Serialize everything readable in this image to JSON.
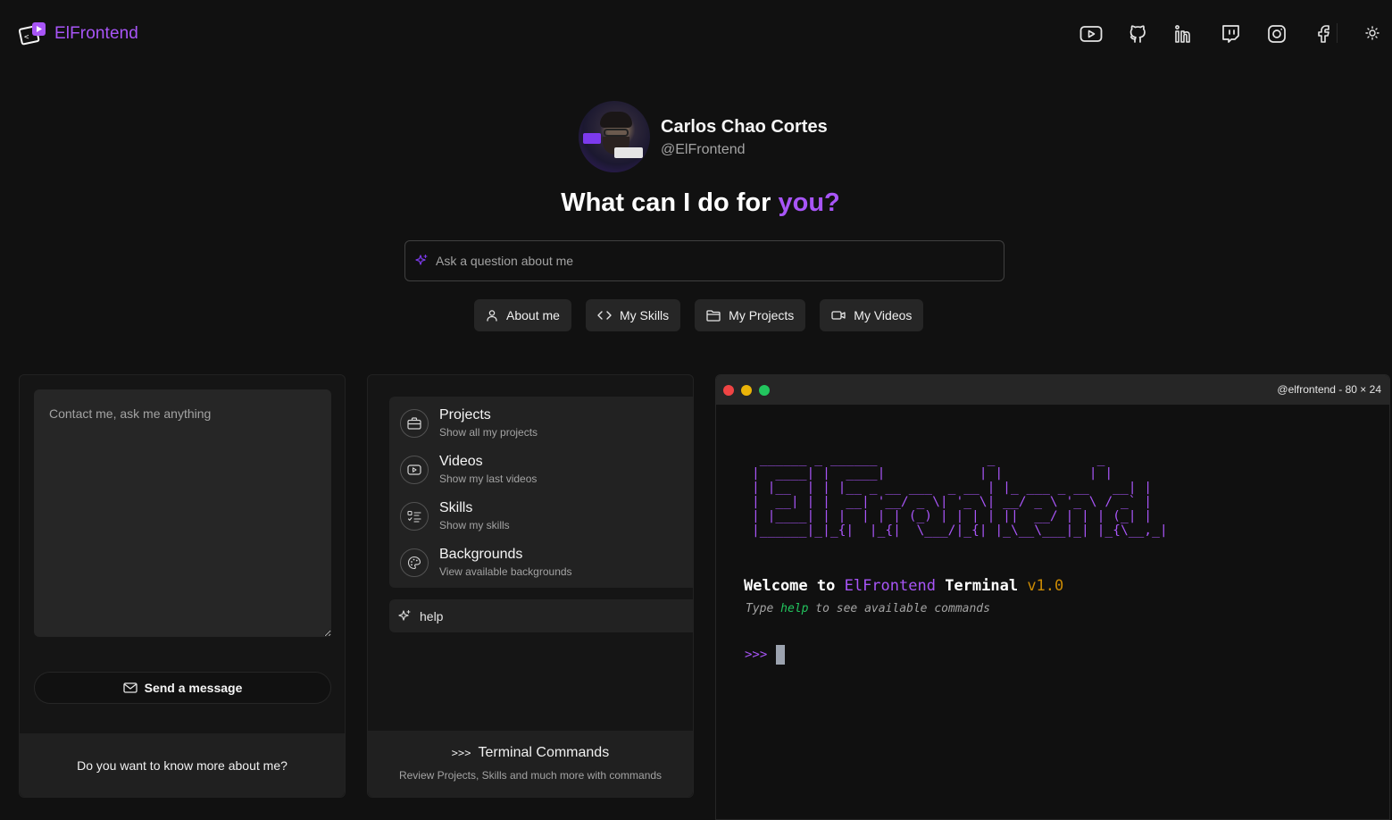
{
  "header": {
    "brand": "ElFrontend",
    "social_icons": [
      "youtube-icon",
      "github-icon",
      "linkedin-icon",
      "twitch-icon",
      "instagram-icon",
      "facebook-icon"
    ],
    "theme_icon": "sun-icon"
  },
  "profile": {
    "name": "Carlos Chao Cortes",
    "handle": "@ElFrontend"
  },
  "hero": {
    "title_prefix": "What can I do for ",
    "title_accent": "you?"
  },
  "ask": {
    "placeholder": "Ask a question about me"
  },
  "pills": [
    {
      "label": "About me",
      "icon": "user-icon"
    },
    {
      "label": "My Skills",
      "icon": "code-icon"
    },
    {
      "label": "My Projects",
      "icon": "folder-icon"
    },
    {
      "label": "My Videos",
      "icon": "video-icon"
    }
  ],
  "contact": {
    "placeholder": "Contact me, ask me anything",
    "send_label": "Send a message",
    "know_more": "Do you want to know more about me?"
  },
  "commands": {
    "items": [
      {
        "title": "Projects",
        "subtitle": "Show all my projects",
        "icon": "briefcase-icon"
      },
      {
        "title": "Videos",
        "subtitle": "Show my last videos",
        "icon": "play-icon"
      },
      {
        "title": "Skills",
        "subtitle": "Show my skills",
        "icon": "list-icon"
      },
      {
        "title": "Backgrounds",
        "subtitle": "View available backgrounds",
        "icon": "palette-icon"
      }
    ],
    "input_value": "help",
    "footer_chevrons": ">>>",
    "footer_title": "Terminal Commands",
    "footer_subtitle": "Review Projects, Skills and much more with commands"
  },
  "terminal": {
    "title": "@elfrontend - 80 × 24",
    "ascii_art": " ______ _ ______              _             _ \n|  ____| |  ____|            | |           | |\n| |__  | | |__ _ __ ___  _ __ | |_ ___ _ __   __| |\n|  __| | |  __| '__/ _ \\| '_ \\| __/ _ \\ '_ \\ / _` |\n| |____| | |  | | | (_) | | | | ||  __/ | | | (_| |\n|______|_|_{|  |_{|  \\___/|_{| |_\\__\\___|_| |_{\\__,_|",
    "welcome_prefix": "Welcome to ",
    "welcome_brand": "ElFrontend",
    "welcome_suffix": " Terminal ",
    "version": "v1.0",
    "hint_prefix": "Type ",
    "hint_cmd": "help",
    "hint_suffix": " to see available commands",
    "prompt": ">>>"
  },
  "colors": {
    "accent": "#a855f7",
    "background": "#111111",
    "version": "#ca8a04",
    "help": "#22c55e"
  }
}
